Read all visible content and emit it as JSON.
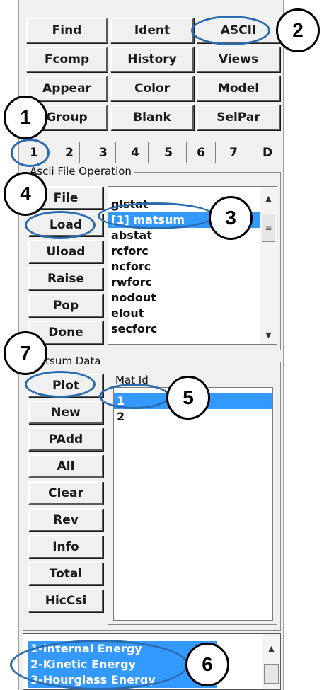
{
  "toolbar": {
    "row1": [
      "Find",
      "Ident",
      "ASCII"
    ],
    "row2": [
      "Fcomp",
      "History",
      "Views"
    ],
    "row3": [
      "Appear",
      "Color",
      "Model"
    ],
    "row4": [
      "Group",
      "Blank",
      "SelPar"
    ]
  },
  "tabs": [
    "1",
    "2",
    "3",
    "4",
    "5",
    "6",
    "7",
    "D"
  ],
  "ascii_section": {
    "title": "Ascii File Operation",
    "buttons": [
      "File",
      "Load",
      "Uload",
      "Raise",
      "Pop",
      "Done"
    ],
    "files": [
      "glstat",
      "[1] matsum",
      "abstat",
      "rcforc",
      "ncforc",
      "rwforc",
      "nodout",
      "elout",
      "secforc"
    ],
    "selected_file": "[1] matsum"
  },
  "matsum_section": {
    "title": "Matsum Data",
    "buttons": [
      "Plot",
      "New",
      "PAdd",
      "All",
      "Clear",
      "Rev",
      "Info",
      "Total",
      "HicCsi"
    ],
    "mat_id_label": "Mat Id",
    "mat_ids": [
      "1",
      "2"
    ],
    "selected_mat_id": "1"
  },
  "components": [
    "1-Internal Energy",
    "2-Kinetic Energy",
    "3-Hourglass Energy"
  ],
  "callouts": [
    "1",
    "2",
    "3",
    "4",
    "5",
    "6",
    "7"
  ],
  "colors": {
    "selection": "#3399ff",
    "annotation": "#2a6bb0",
    "panel": "#f0f0f0"
  }
}
